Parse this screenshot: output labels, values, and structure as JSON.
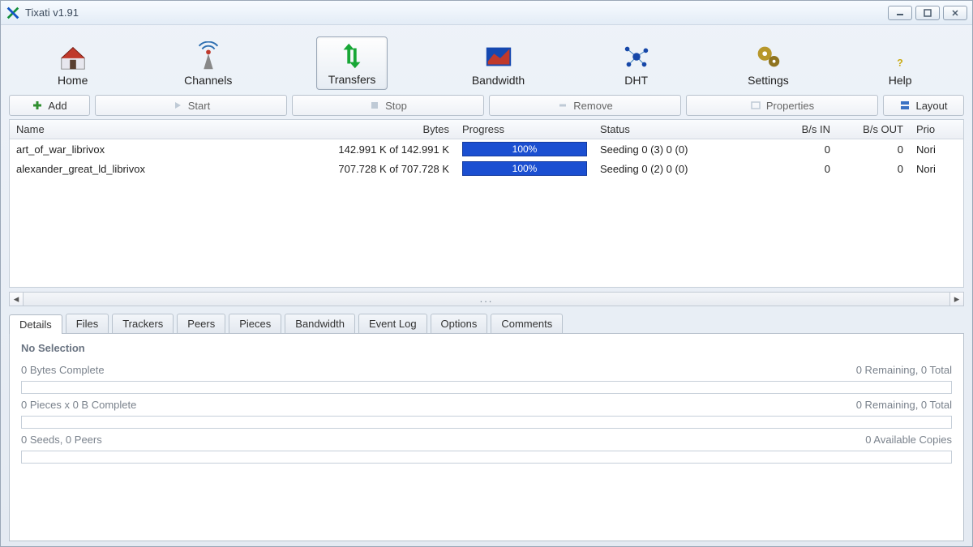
{
  "app": {
    "title": "Tixati v1.91"
  },
  "nav": {
    "home": "Home",
    "channels": "Channels",
    "transfers": "Transfers",
    "bandwidth": "Bandwidth",
    "dht": "DHT",
    "settings": "Settings",
    "help": "Help"
  },
  "actions": {
    "add": "Add",
    "start": "Start",
    "stop": "Stop",
    "remove": "Remove",
    "properties": "Properties",
    "layout": "Layout"
  },
  "columns": {
    "name": "Name",
    "bytes": "Bytes",
    "progress": "Progress",
    "status": "Status",
    "bin": "B/s IN",
    "bout": "B/s OUT",
    "prio": "Prio"
  },
  "transfers": [
    {
      "name": "art_of_war_librivox",
      "bytes": "142.991 K of 142.991 K",
      "progress": "100%",
      "status": "Seeding 0 (3) 0 (0)",
      "bin": "0",
      "bout": "0",
      "prio": "Nori"
    },
    {
      "name": "alexander_great_ld_librivox",
      "bytes": "707.728 K of 707.728 K",
      "progress": "100%",
      "status": "Seeding 0 (2) 0 (0)",
      "bin": "0",
      "bout": "0",
      "prio": "Nori"
    }
  ],
  "tabs": [
    "Details",
    "Files",
    "Trackers",
    "Peers",
    "Pieces",
    "Bandwidth",
    "Event Log",
    "Options",
    "Comments"
  ],
  "details": {
    "heading": "No Selection",
    "row1_left": "0 Bytes Complete",
    "row1_right": "0 Remaining,  0 Total",
    "row2_left": "0 Pieces  x  0 B Complete",
    "row2_right": "0 Remaining,  0 Total",
    "row3_left": "0 Seeds, 0 Peers",
    "row3_right": "0 Available Copies"
  }
}
